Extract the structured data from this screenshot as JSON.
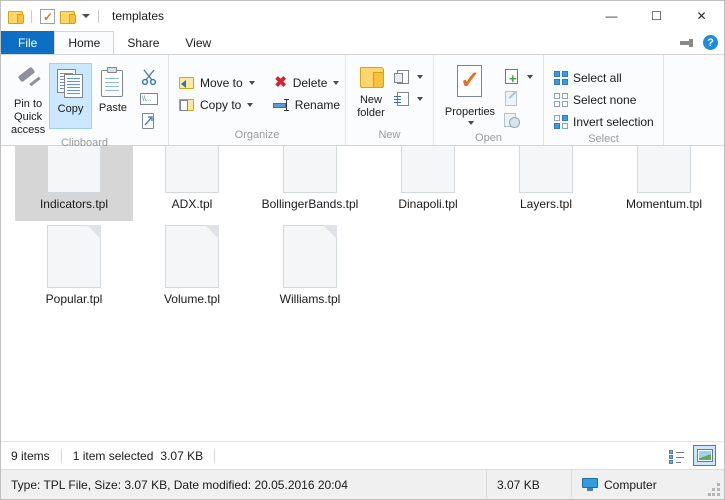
{
  "titlebar": {
    "title": "templates",
    "qat": [
      {
        "name": "folder-icon"
      },
      {
        "name": "properties-icon"
      },
      {
        "name": "folder-icon"
      },
      {
        "name": "chevron-down-icon"
      }
    ],
    "minimize": "—",
    "maximize": "☐",
    "close": "✕"
  },
  "tabs": [
    {
      "label": "File",
      "state": "file"
    },
    {
      "label": "Home",
      "state": "active"
    },
    {
      "label": "Share",
      "state": "normal"
    },
    {
      "label": "View",
      "state": "normal"
    }
  ],
  "ribbon_right": {
    "collapse_label": "",
    "help_label": "?"
  },
  "ribbon": {
    "groups": [
      {
        "label": "Clipboard",
        "big": [
          {
            "label": "Pin to Quick access",
            "icon": "pin-icon",
            "selected": false
          },
          {
            "label": "Copy",
            "icon": "copy-icon",
            "selected": true
          },
          {
            "label": "Paste",
            "icon": "paste-icon",
            "selected": false
          }
        ],
        "small": [
          {
            "label": "",
            "icon": "cut-icon"
          },
          {
            "label": "",
            "icon": "copy-path-icon"
          },
          {
            "label": "",
            "icon": "paste-shortcut-icon"
          }
        ]
      },
      {
        "label": "Organize",
        "small": [
          {
            "label": "Move to",
            "icon": "move-to-icon",
            "caret": true
          },
          {
            "label": "Copy to",
            "icon": "copy-to-icon",
            "caret": true
          },
          {
            "label": "Delete",
            "icon": "delete-icon",
            "caret": true
          },
          {
            "label": "Rename",
            "icon": "rename-icon",
            "caret": false
          }
        ]
      },
      {
        "label": "New",
        "big": [
          {
            "label": "New folder",
            "icon": "new-folder-icon",
            "selected": false
          }
        ],
        "small": [
          {
            "label": "",
            "icon": "new-item-icon",
            "caret": true
          },
          {
            "label": "",
            "icon": "easy-access-icon",
            "caret": true
          }
        ]
      },
      {
        "label": "Open",
        "big": [
          {
            "label": "Properties",
            "icon": "properties-icon",
            "selected": false
          }
        ],
        "small": [
          {
            "label": "",
            "icon": "open-icon",
            "caret": true
          },
          {
            "label": "",
            "icon": "edit-icon",
            "caret": false
          },
          {
            "label": "",
            "icon": "history-icon",
            "caret": false
          }
        ]
      },
      {
        "label": "Select",
        "small": [
          {
            "label": "Select all",
            "icon": "select-all-icon"
          },
          {
            "label": "Select none",
            "icon": "select-none-icon"
          },
          {
            "label": "Invert selection",
            "icon": "invert-selection-icon"
          }
        ]
      }
    ]
  },
  "files": [
    {
      "name": "Indicators.tpl",
      "selected": true
    },
    {
      "name": "ADX.tpl",
      "selected": false
    },
    {
      "name": "BollingerBands.tpl",
      "selected": false
    },
    {
      "name": "Dinapoli.tpl",
      "selected": false
    },
    {
      "name": "Layers.tpl",
      "selected": false
    },
    {
      "name": "Momentum.tpl",
      "selected": false
    },
    {
      "name": "Popular.tpl",
      "selected": false
    },
    {
      "name": "Volume.tpl",
      "selected": false
    },
    {
      "name": "Williams.tpl",
      "selected": false
    }
  ],
  "statusbar": {
    "item_count": "9 items",
    "selection": "1 item selected",
    "selection_size": "3.07 KB",
    "view_details_label": "details-view",
    "view_thumbnails_label": "large-icons-view"
  },
  "detailsbar": {
    "description": "Type: TPL File, Size: 3.07 KB, Date modified: 20.05.2016 20:04",
    "size": "3.07 KB",
    "location": "Computer"
  },
  "colors": {
    "file_tab": "#0d6fc4",
    "selection": "#d6d6d6",
    "accent": "#1d8bdc"
  }
}
